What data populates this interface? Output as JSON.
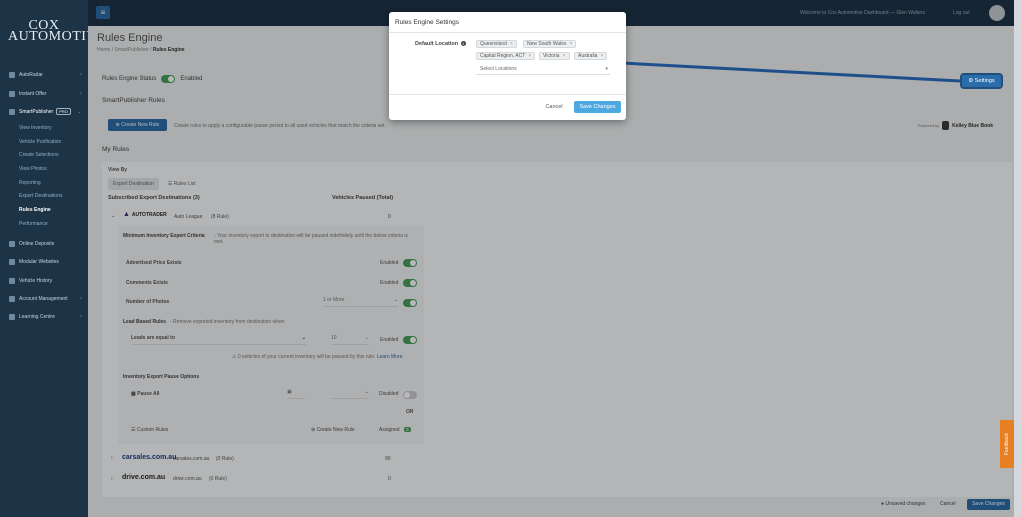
{
  "brand": {
    "line1": "COX",
    "line2": "AUTOMOTIVE"
  },
  "nav": {
    "items": [
      {
        "label": "AutoRadar",
        "has_children": true
      },
      {
        "label": "Instant Offer",
        "has_children": true
      },
      {
        "label": "SmartPublisher",
        "badge": "PRO",
        "has_children": true
      }
    ],
    "sub_items": [
      {
        "label": "View Inventory"
      },
      {
        "label": "Vehicle Purification"
      },
      {
        "label": "Create Selections"
      },
      {
        "label": "View Photos"
      },
      {
        "label": "Reporting"
      },
      {
        "label": "Export Destinations"
      },
      {
        "label": "Rules Engine",
        "active": true
      },
      {
        "label": "Performance"
      }
    ],
    "items_bottom": [
      {
        "label": "Online Deposits"
      },
      {
        "label": "Modular Websites"
      },
      {
        "label": "Vehicle History"
      },
      {
        "label": "Account Management",
        "has_children": true
      },
      {
        "label": "Learning Centre",
        "has_children": true
      }
    ]
  },
  "topbar": {
    "welcome": "Welcome to Cox Automotive Dashboard — Glen Walters",
    "logout": "Log out"
  },
  "page": {
    "title": "Rules Engine",
    "breadcrumb": [
      "Home",
      "SmartPublisher",
      "Rules Engine"
    ],
    "status_label": "Rules Engine Status",
    "status_value": "Enabled",
    "settings_label": "Settings",
    "rules_section": "SmartPublisher Rules",
    "create_rule": "Create New Rule",
    "create_desc": "Create rules to apply a configurable pause period to all used vehicles that match the criteria set.",
    "powered_by": "Powered by",
    "kbb": "Kelley Blue Book",
    "my_rules": "My Rules",
    "view_by": "View By",
    "tab_export": "Export Destination",
    "tab_rules": "Rules List",
    "col_destinations": "Subscribed Export Destinations (3)",
    "col_paused": "Vehicles Paused (Total)",
    "dest1": {
      "brand": "AUTOTRADER",
      "sub": "Auto League",
      "rules": "(8 Rule)",
      "count": "0"
    },
    "min_criteria_title": "Minimum Inventory Expert Criteria",
    "min_criteria_desc": "- Your inventory export to destination will be paused indefinitely until the below criteria is met.",
    "c_price": "Advertised Price Exists",
    "c_comments": "Comments Exists",
    "c_photos": "Number of Photos",
    "c_photos_val": "1 or More",
    "enabled": "Enabled",
    "lead_title": "Lead Based Rules",
    "lead_desc": "- Remove exported inventory from destination when",
    "leads_equal": "Leads are equal to",
    "leads_val": "10",
    "leads_note": "0 vehicles of your current inventory will be paused by this rule.",
    "learn_more": "Learn More",
    "pause_title": "Inventory Export Pause Options",
    "pause_all": "Pause All",
    "disabled": "Disabled",
    "or": "OR",
    "custom_rules": "Custom Rules",
    "create_new_rule": "Create New Rule",
    "assigned": "Assigned",
    "assigned_count": "0",
    "dest2": {
      "brand": "carsales.com.au",
      "domain": "carsales.com.au",
      "rules": "(0 Rule)",
      "count": "90"
    },
    "dest3": {
      "brand": "drive.com.au",
      "domain": "drive.com.au",
      "rules": "(0 Rule)",
      "count": "0"
    },
    "unsaved": "Unsaved changes",
    "cancel": "Cancel",
    "save": "Save Changes",
    "feedback": "Feedback"
  },
  "modal": {
    "title": "Rules Engine Settings",
    "default_location_label": "Default Location",
    "tags": [
      "Queensland",
      "New South Wales",
      "Capital Region, ACT",
      "Victoria",
      "Australia"
    ],
    "select_placeholder": "Select Locations",
    "cancel": "Cancel",
    "save": "Save Changes"
  },
  "colors": {
    "sidebar": "#1d3346",
    "primary": "#2b6da8",
    "modal_save": "#4ea9e0",
    "toggle_on": "#48a05a",
    "annotation_arrow": "#1e4f8a"
  }
}
